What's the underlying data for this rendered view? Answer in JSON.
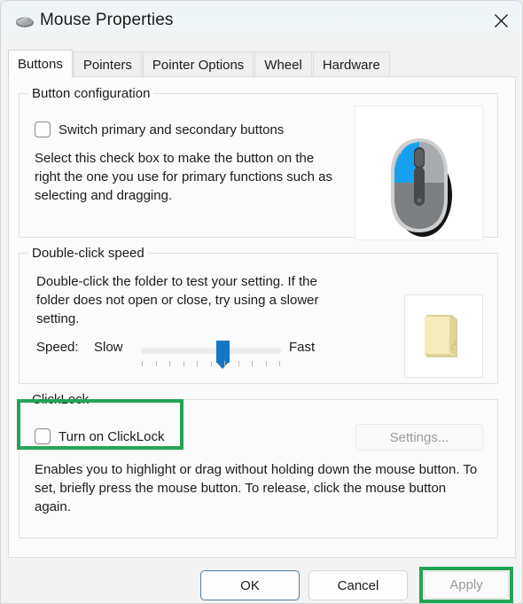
{
  "window": {
    "title": "Mouse Properties",
    "icon": "mouse-icon",
    "close_label": "✕"
  },
  "tabs": [
    {
      "label": "Buttons",
      "active": true
    },
    {
      "label": "Pointers",
      "active": false
    },
    {
      "label": "Pointer Options",
      "active": false
    },
    {
      "label": "Wheel",
      "active": false
    },
    {
      "label": "Hardware",
      "active": false
    }
  ],
  "button_configuration": {
    "legend": "Button configuration",
    "switch_checkbox_label": "Switch primary and secondary buttons",
    "switch_checkbox_checked": false,
    "description": "Select this check box to make the button on the right the one you use for primary functions such as selecting and dragging.",
    "preview_icon": "computer-mouse-image"
  },
  "double_click_speed": {
    "legend": "Double-click speed",
    "description": "Double-click the folder to test your setting. If the folder does not open or close, try using a slower setting.",
    "speed_label": "Speed:",
    "slow_label": "Slow",
    "fast_label": "Fast",
    "slider_value": 55,
    "slider_min": 0,
    "slider_max": 100,
    "tick_count": 11,
    "preview_icon": "folder-image"
  },
  "clicklock": {
    "legend": "ClickLock",
    "checkbox_label": "Turn on ClickLock",
    "checkbox_checked": false,
    "settings_button_label": "Settings...",
    "settings_button_enabled": false,
    "description": "Enables you to highlight or drag without holding down the mouse button. To set, briefly press the mouse button. To release, click the mouse button again."
  },
  "footer": {
    "ok_label": "OK",
    "cancel_label": "Cancel",
    "apply_label": "Apply",
    "apply_enabled": false
  },
  "annotations": {
    "highlight_color": "#23a455",
    "targets": [
      "clicklock-group",
      "apply-button"
    ]
  }
}
